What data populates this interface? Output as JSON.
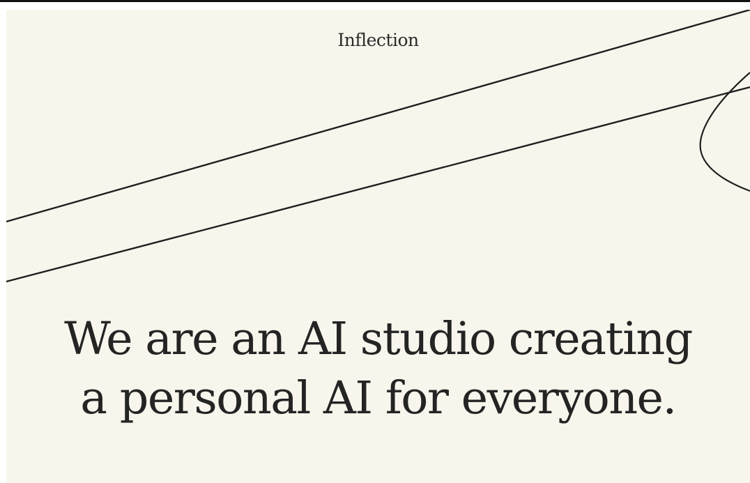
{
  "brand": {
    "name": "Inflection"
  },
  "hero": {
    "line1": "We are an AI studio creating",
    "line2": "a personal AI for everyone."
  },
  "colors": {
    "background": "#f8f5ec",
    "text": "#242424",
    "stroke": "#1f1f1f"
  }
}
